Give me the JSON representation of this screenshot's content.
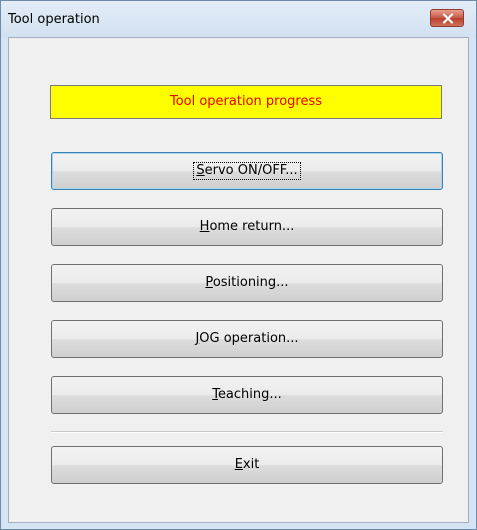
{
  "window": {
    "title": "Tool operation",
    "close_icon": "close-icon"
  },
  "progress": {
    "text": "Tool operation progress"
  },
  "buttons": [
    {
      "mnemonic": "S",
      "rest": "ervo ON/OFF..."
    },
    {
      "mnemonic": "H",
      "rest": "ome return..."
    },
    {
      "prefix": "",
      "mnemonic": "P",
      "rest": "ositioning..."
    },
    {
      "mnemonic": "J",
      "rest": "OG operation..."
    },
    {
      "mnemonic": "T",
      "rest": "eaching..."
    },
    {
      "mnemonic": "E",
      "rest": "xit"
    }
  ],
  "colors": {
    "progress_background": "#ffff00",
    "progress_text": "#e60000",
    "focus_border": "#3c7fb1"
  }
}
